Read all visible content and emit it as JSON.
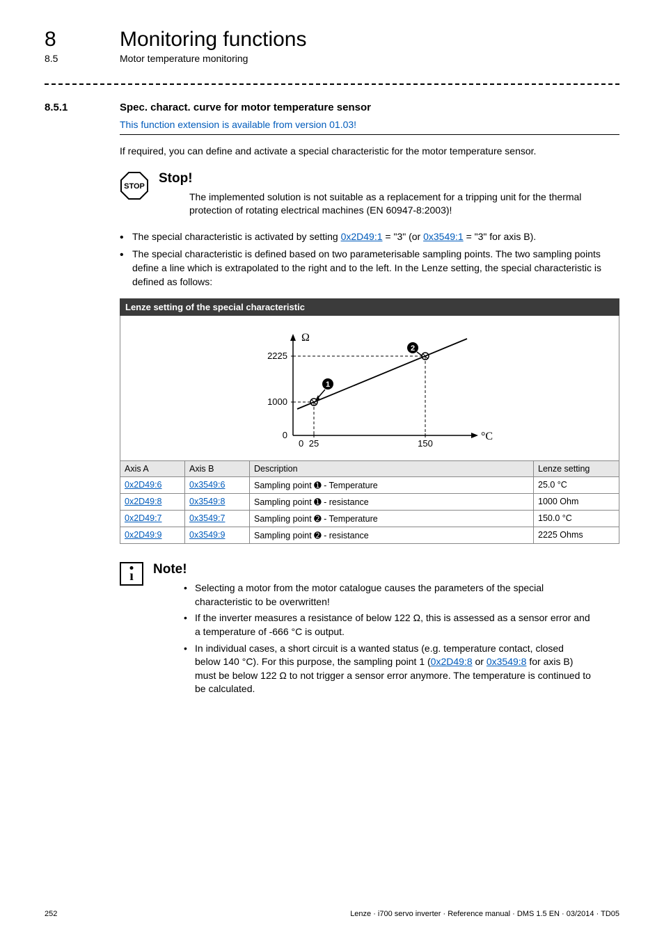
{
  "header": {
    "chapter_num": "8",
    "chapter_title": "Monitoring functions",
    "section_num": "8.5",
    "section_title": "Motor temperature monitoring"
  },
  "subsection": {
    "num": "8.5.1",
    "title": "Spec. charact.  curve for motor temperature sensor",
    "version_note": "This function extension is available from version 01.03!",
    "intro": "If required, you can define and activate a special characteristic for the motor temperature sensor."
  },
  "stop_box": {
    "head": "Stop!",
    "text": "The implemented solution is not suitable as a replacement for a tripping unit for the thermal protection of rotating electrical machines (EN 60947-8:2003)!"
  },
  "bullets": {
    "b1_pre": "The special characteristic is activated by setting ",
    "b1_link1": "0x2D49:1",
    "b1_mid1": " = \"3\" (or ",
    "b1_link2": "0x3549:1",
    "b1_mid2": " = \"3\" for axis B).",
    "b2": "The special characteristic is defined based on two parameterisable sampling points. The two sampling points define a line which is extrapolated to the right and to the left. In the Lenze setting, the special characteristic is defined as follows:"
  },
  "figure": {
    "caption": "Lenze setting of the special characteristic",
    "y_label": "Ω",
    "x_label": "°C",
    "columns": {
      "axisA": "Axis A",
      "axisB": "Axis B",
      "desc": "Description",
      "setting": "Lenze setting"
    },
    "rows": [
      {
        "a": "0x2D49:6",
        "b": "0x3549:6",
        "desc_pre": "Sampling point ",
        "desc_num": "➊",
        "desc_post": " - Temperature",
        "setting": "25.0 °C"
      },
      {
        "a": "0x2D49:8",
        "b": "0x3549:8",
        "desc_pre": "Sampling point ",
        "desc_num": "➊",
        "desc_post": " - resistance",
        "setting": "1000 Ohm"
      },
      {
        "a": "0x2D49:7",
        "b": "0x3549:7",
        "desc_pre": "Sampling point ",
        "desc_num": "➋",
        "desc_post": " - Temperature",
        "setting": "150.0 °C"
      },
      {
        "a": "0x2D49:9",
        "b": "0x3549:9",
        "desc_pre": "Sampling point ",
        "desc_num": "➋",
        "desc_post": " - resistance",
        "setting": "2225 Ohms"
      }
    ]
  },
  "chart_data": {
    "type": "line",
    "title": "Lenze setting of the special characteristic",
    "xlabel": "°C",
    "ylabel": "Ω",
    "x_ticks": [
      0,
      25,
      150
    ],
    "y_ticks": [
      0,
      1000,
      2225
    ],
    "xlim": [
      0,
      200
    ],
    "ylim": [
      0,
      2600
    ],
    "series": [
      {
        "name": "special characteristic (extrapolated line)"
      }
    ],
    "sampling_points": [
      {
        "id": 1,
        "x": 25,
        "y": 1000
      },
      {
        "id": 2,
        "x": 150,
        "y": 2225
      }
    ]
  },
  "note_box": {
    "head": "Note!",
    "items": {
      "n1": "Selecting a motor from the motor catalogue causes the parameters of the special characteristic to be overwritten!",
      "n2": "If the inverter measures a resistance of below 122 Ω, this is assessed as a sensor error and a temperature of -666 °C is output.",
      "n3_pre": "In individual cases, a short circuit is a wanted status (e.g. temperature contact, closed below 140 °C). For this purpose, the sampling point 1 (",
      "n3_link1": "0x2D49:8",
      "n3_mid": " or ",
      "n3_link2": "0x3549:8",
      "n3_post": " for axis B) must be below 122 Ω  to not trigger a sensor error anymore. The temperature is continued to be calculated."
    }
  },
  "footer": {
    "page": "252",
    "meta": "Lenze · i700 servo inverter · Reference manual · DMS 1.5 EN · 03/2014 · TD05"
  }
}
